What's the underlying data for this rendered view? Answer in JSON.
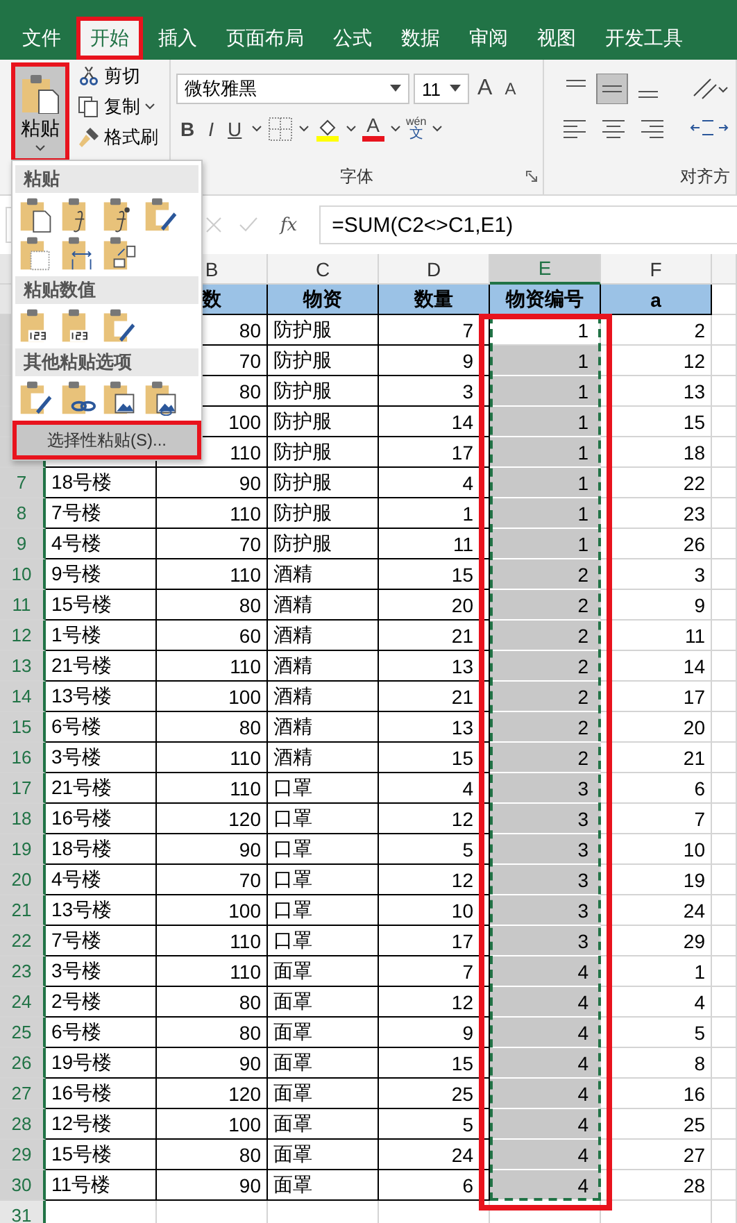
{
  "tabs": [
    {
      "label": "文件",
      "selected": false
    },
    {
      "label": "开始",
      "selected": true,
      "highlighted": true
    },
    {
      "label": "插入",
      "selected": false
    },
    {
      "label": "页面布局",
      "selected": false
    },
    {
      "label": "公式",
      "selected": false
    },
    {
      "label": "数据",
      "selected": false
    },
    {
      "label": "审阅",
      "selected": false
    },
    {
      "label": "视图",
      "selected": false
    },
    {
      "label": "开发工具",
      "selected": false
    }
  ],
  "clipboard": {
    "paste_label": "粘贴",
    "paste_highlighted": true,
    "commands": [
      {
        "kind": "cut",
        "label": "剪切"
      },
      {
        "kind": "copy",
        "label": "复制"
      },
      {
        "kind": "format-painter",
        "label": "格式刷"
      }
    ]
  },
  "font": {
    "name": "微软雅黑",
    "size": "11",
    "grow": "A",
    "shrink": "A",
    "bold": "B",
    "italic": "I",
    "underline": "U",
    "color_letter": "A",
    "phonetic_top": "wén",
    "phonetic_bottom": "文",
    "group_label": "字体"
  },
  "alignment": {
    "group_label": "对齐方"
  },
  "paste_menu": {
    "sections": [
      {
        "title": "粘贴"
      },
      {
        "title": "粘贴数值"
      },
      {
        "title": "其他粘贴选项"
      }
    ],
    "special": {
      "label": "选择性粘贴(S)...",
      "highlighted": true
    }
  },
  "formula_bar": {
    "fx": "fx",
    "formula": "=SUM(C2<>C1,E1)"
  },
  "sheet": {
    "columns": [
      {
        "letter": "B",
        "selected": false
      },
      {
        "letter": "C",
        "selected": false
      },
      {
        "letter": "D",
        "selected": false
      },
      {
        "letter": "E",
        "selected": true
      },
      {
        "letter": "F",
        "selected": false
      }
    ],
    "header": {
      "b": "数",
      "c": "物资",
      "d": "数量",
      "e": "物资编号",
      "f": "a"
    },
    "highlight_column": true,
    "rows": [
      {
        "b": "80",
        "c": "防护服",
        "d": "7",
        "e": "1",
        "f": "2",
        "selected": true,
        "active": true
      },
      {
        "b": "70",
        "c": "防护服",
        "d": "9",
        "e": "1",
        "f": "12",
        "selected": true
      },
      {
        "b": "80",
        "c": "防护服",
        "d": "3",
        "e": "1",
        "f": "13",
        "selected": true
      },
      {
        "b": "100",
        "c": "防护服",
        "d": "14",
        "e": "1",
        "f": "15",
        "selected": true
      },
      {
        "b": "110",
        "c": "防护服",
        "d": "17",
        "e": "1",
        "f": "18",
        "selected": true
      },
      {
        "num": "7",
        "a": "18号楼",
        "b": "90",
        "c": "防护服",
        "d": "4",
        "e": "1",
        "f": "22",
        "selected": true
      },
      {
        "num": "8",
        "a": "7号楼",
        "b": "110",
        "c": "防护服",
        "d": "1",
        "e": "1",
        "f": "23",
        "selected": true
      },
      {
        "num": "9",
        "a": "4号楼",
        "b": "70",
        "c": "防护服",
        "d": "11",
        "e": "1",
        "f": "26",
        "selected": true
      },
      {
        "num": "10",
        "a": "9号楼",
        "b": "110",
        "c": "酒精",
        "d": "15",
        "e": "2",
        "f": "3",
        "selected": true
      },
      {
        "num": "11",
        "a": "15号楼",
        "b": "80",
        "c": "酒精",
        "d": "20",
        "e": "2",
        "f": "9",
        "selected": true
      },
      {
        "num": "12",
        "a": "1号楼",
        "b": "60",
        "c": "酒精",
        "d": "21",
        "e": "2",
        "f": "11",
        "selected": true
      },
      {
        "num": "13",
        "a": "21号楼",
        "b": "110",
        "c": "酒精",
        "d": "13",
        "e": "2",
        "f": "14",
        "selected": true
      },
      {
        "num": "14",
        "a": "13号楼",
        "b": "100",
        "c": "酒精",
        "d": "21",
        "e": "2",
        "f": "17",
        "selected": true
      },
      {
        "num": "15",
        "a": "6号楼",
        "b": "80",
        "c": "酒精",
        "d": "13",
        "e": "2",
        "f": "20",
        "selected": true
      },
      {
        "num": "16",
        "a": "3号楼",
        "b": "110",
        "c": "酒精",
        "d": "15",
        "e": "2",
        "f": "21",
        "selected": true
      },
      {
        "num": "17",
        "a": "21号楼",
        "b": "110",
        "c": "口罩",
        "d": "4",
        "e": "3",
        "f": "6",
        "selected": true
      },
      {
        "num": "18",
        "a": "16号楼",
        "b": "120",
        "c": "口罩",
        "d": "12",
        "e": "3",
        "f": "7",
        "selected": true
      },
      {
        "num": "19",
        "a": "18号楼",
        "b": "90",
        "c": "口罩",
        "d": "5",
        "e": "3",
        "f": "10",
        "selected": true
      },
      {
        "num": "20",
        "a": "4号楼",
        "b": "70",
        "c": "口罩",
        "d": "12",
        "e": "3",
        "f": "19",
        "selected": true
      },
      {
        "num": "21",
        "a": "13号楼",
        "b": "100",
        "c": "口罩",
        "d": "10",
        "e": "3",
        "f": "24",
        "selected": true
      },
      {
        "num": "22",
        "a": "7号楼",
        "b": "110",
        "c": "口罩",
        "d": "17",
        "e": "3",
        "f": "29",
        "selected": true
      },
      {
        "num": "23",
        "a": "3号楼",
        "b": "110",
        "c": "面罩",
        "d": "7",
        "e": "4",
        "f": "1",
        "selected": true
      },
      {
        "num": "24",
        "a": "2号楼",
        "b": "80",
        "c": "面罩",
        "d": "12",
        "e": "4",
        "f": "4",
        "selected": true
      },
      {
        "num": "25",
        "a": "6号楼",
        "b": "80",
        "c": "面罩",
        "d": "9",
        "e": "4",
        "f": "5",
        "selected": true
      },
      {
        "num": "26",
        "a": "19号楼",
        "b": "90",
        "c": "面罩",
        "d": "15",
        "e": "4",
        "f": "8",
        "selected": true
      },
      {
        "num": "27",
        "a": "16号楼",
        "b": "120",
        "c": "面罩",
        "d": "25",
        "e": "4",
        "f": "16",
        "selected": true
      },
      {
        "num": "28",
        "a": "12号楼",
        "b": "100",
        "c": "面罩",
        "d": "5",
        "e": "4",
        "f": "25",
        "selected": true
      },
      {
        "num": "29",
        "a": "15号楼",
        "b": "80",
        "c": "面罩",
        "d": "24",
        "e": "4",
        "f": "27",
        "selected": true
      },
      {
        "num": "30",
        "a": "11号楼",
        "b": "90",
        "c": "面罩",
        "d": "6",
        "e": "4",
        "f": "28",
        "selected": true
      },
      {
        "num": "31",
        "selected": false
      }
    ]
  }
}
